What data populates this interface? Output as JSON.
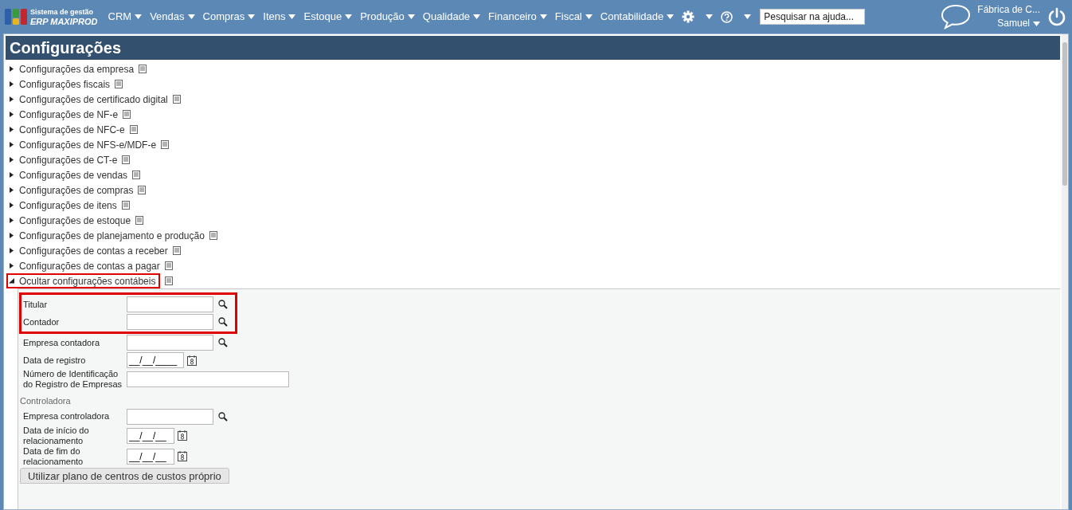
{
  "header": {
    "logo_line1": "Sistema de gestão",
    "logo_line2": "ERP MAXIPROD",
    "menu": [
      {
        "kind": "text",
        "label": "CRM"
      },
      {
        "kind": "text",
        "label": "Vendas"
      },
      {
        "kind": "text",
        "label": "Compras"
      },
      {
        "kind": "text",
        "label": "Itens"
      },
      {
        "kind": "text",
        "label": "Estoque"
      },
      {
        "kind": "text",
        "label": "Produção"
      },
      {
        "kind": "text",
        "label": "Qualidade"
      },
      {
        "kind": "text",
        "label": "Financeiro"
      },
      {
        "kind": "text",
        "label": "Fiscal"
      },
      {
        "kind": "text",
        "label": "Contabilidade"
      },
      {
        "kind": "settings"
      },
      {
        "kind": "help"
      }
    ],
    "search": {
      "placeholder": "Pesquisar na ajuda..."
    },
    "company": "Fábrica de C...",
    "user": "Samuel"
  },
  "page": {
    "title": "Configurações"
  },
  "sections": [
    {
      "label": "Configurações da empresa",
      "expanded": false,
      "highlighted": false
    },
    {
      "label": "Configurações fiscais",
      "expanded": false,
      "highlighted": false
    },
    {
      "label": "Configurações de certificado digital",
      "expanded": false,
      "highlighted": false
    },
    {
      "label": "Configurações de NF-e",
      "expanded": false,
      "highlighted": false
    },
    {
      "label": "Configurações de NFC-e",
      "expanded": false,
      "highlighted": false
    },
    {
      "label": "Configurações de NFS-e/MDF-e",
      "expanded": false,
      "highlighted": false
    },
    {
      "label": "Configurações de CT-e",
      "expanded": false,
      "highlighted": false
    },
    {
      "label": "Configurações de vendas",
      "expanded": false,
      "highlighted": false
    },
    {
      "label": "Configurações de compras",
      "expanded": false,
      "highlighted": false
    },
    {
      "label": "Configurações de itens",
      "expanded": false,
      "highlighted": false
    },
    {
      "label": "Configurações de estoque",
      "expanded": false,
      "highlighted": false
    },
    {
      "label": "Configurações de planejamento e produção",
      "expanded": false,
      "highlighted": false
    },
    {
      "label": "Configurações de contas a receber",
      "expanded": false,
      "highlighted": false
    },
    {
      "label": "Configurações de contas a pagar",
      "expanded": false,
      "highlighted": false
    },
    {
      "label": "Ocultar configurações contábeis",
      "expanded": true,
      "highlighted": true
    }
  ],
  "accounting": {
    "fields": [
      {
        "kind": "lookup",
        "label": "Titular",
        "highlighted": true
      },
      {
        "kind": "lookup",
        "label": "Contador",
        "highlighted": true
      },
      {
        "kind": "lookup",
        "label": "Empresa contadora",
        "highlighted": false
      },
      {
        "kind": "date",
        "label": "Data de registro",
        "value": "__/__/____",
        "highlighted": false
      },
      {
        "kind": "text",
        "label": "Número de Identificação do Registro de Empresas",
        "highlighted": false
      }
    ],
    "controller_heading": "Controladora",
    "controller_fields": [
      {
        "kind": "lookup",
        "label": "Empresa controladora",
        "highlighted": false
      },
      {
        "kind": "date_short",
        "label": "Data de início do relacionamento",
        "value": "__/__/__",
        "highlighted": false
      },
      {
        "kind": "date_short",
        "label": "Data de fim do relacionamento",
        "value": "__/__/__",
        "highlighted": false
      }
    ],
    "button": "Utilizar plano de centros de custos próprio"
  }
}
